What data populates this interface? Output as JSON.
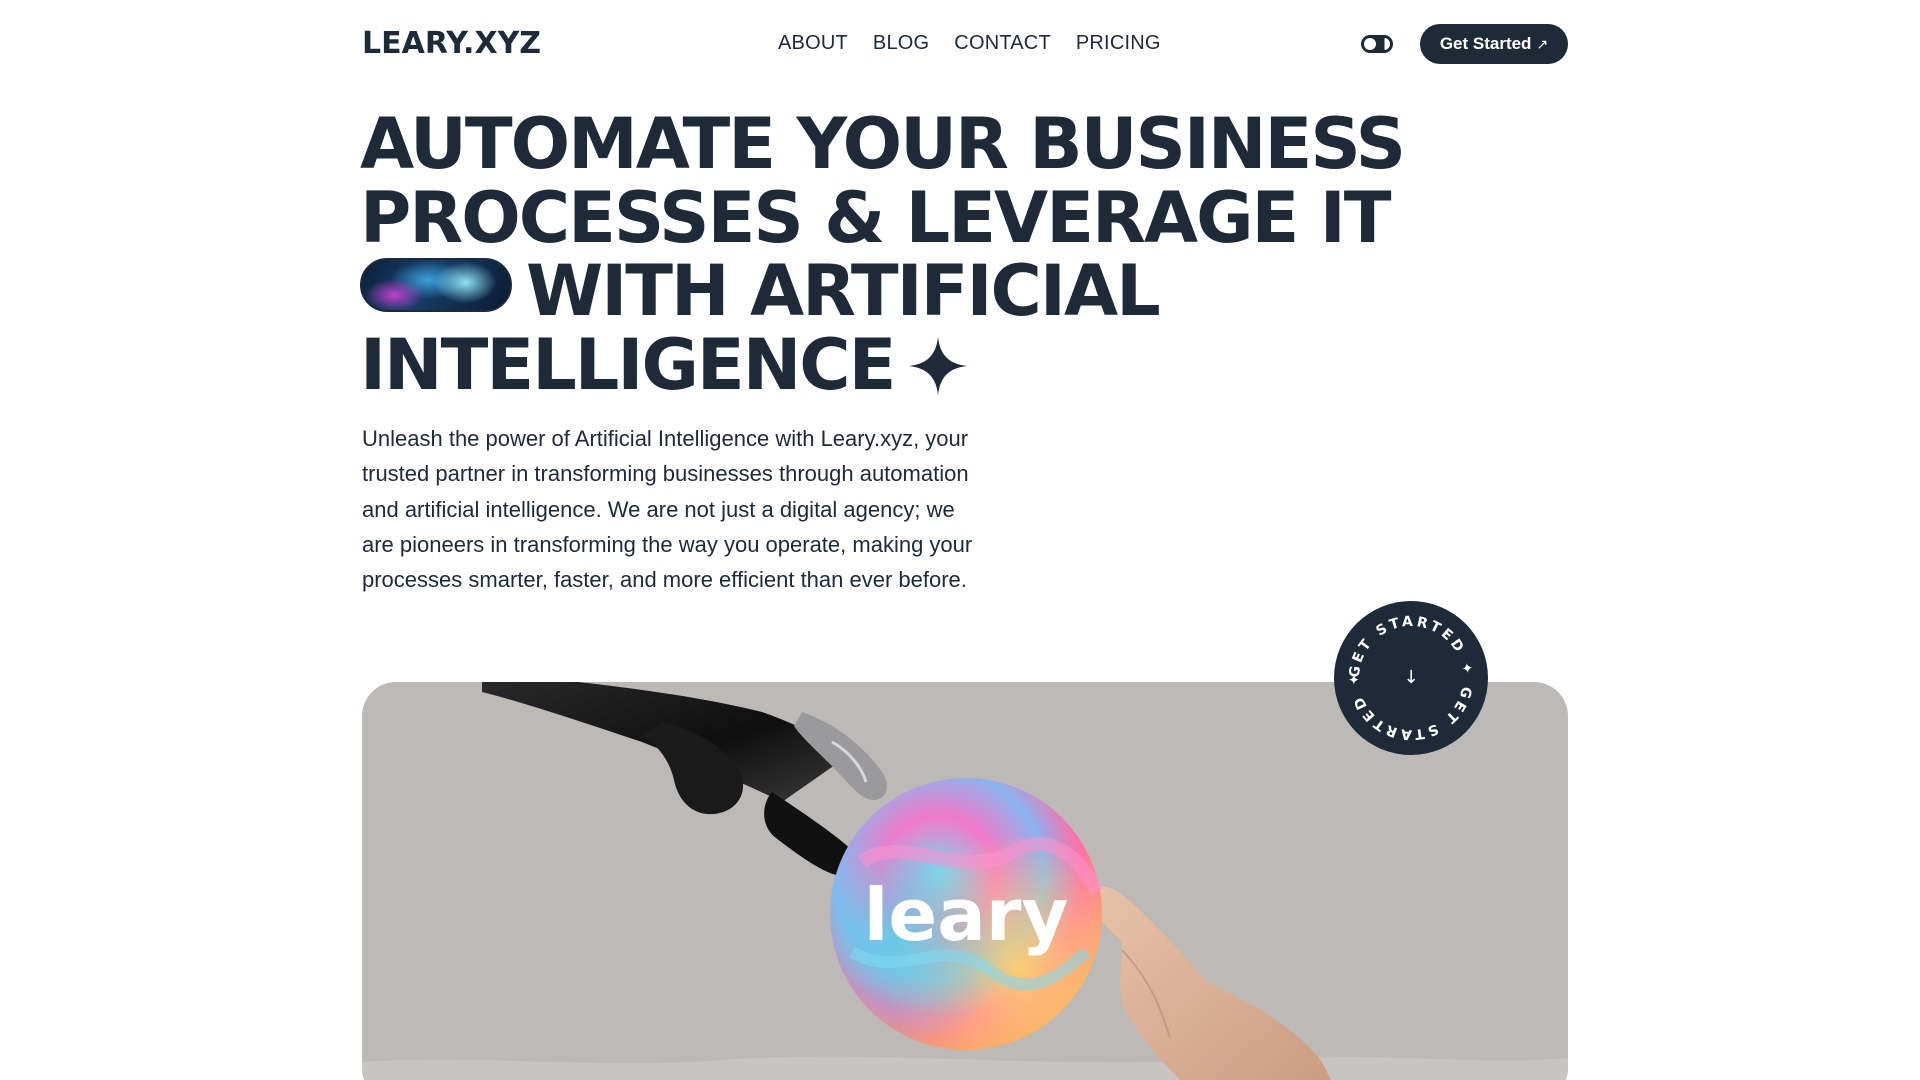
{
  "header": {
    "logo": "LEARY.XYZ",
    "nav": [
      "ABOUT",
      "BLOG",
      "CONTACT",
      "PRICING"
    ],
    "cta_label": "Get Started",
    "cta_arrow": "↗"
  },
  "hero": {
    "title_lines": [
      "AUTOMATE YOUR BUSINESS",
      "PROCESSES & LEVERAGE IT",
      "WITH ARTIFICIAL",
      "INTELLIGENCE"
    ],
    "description": "Unleash the power of Artificial Intelligence with Leary.xyz, your trusted partner in transforming businesses through automation and artificial intelligence. We are not just a digital agency; we are pioneers in transforming the way you operate, making your processes smarter, faster, and more efficient than ever before."
  },
  "badge": {
    "ring_text": "GET STARTED ✦ GET STARTED ✦",
    "arrow": "↓"
  },
  "image": {
    "brand_text": "leary"
  },
  "colors": {
    "primary": "#1e2a38",
    "card_bg": "#bdb9b6",
    "background": "#ffffff"
  },
  "icons": [
    "theme-toggle-icon",
    "sparkle-icon",
    "arrow-up-right-icon",
    "arrow-down-icon"
  ]
}
